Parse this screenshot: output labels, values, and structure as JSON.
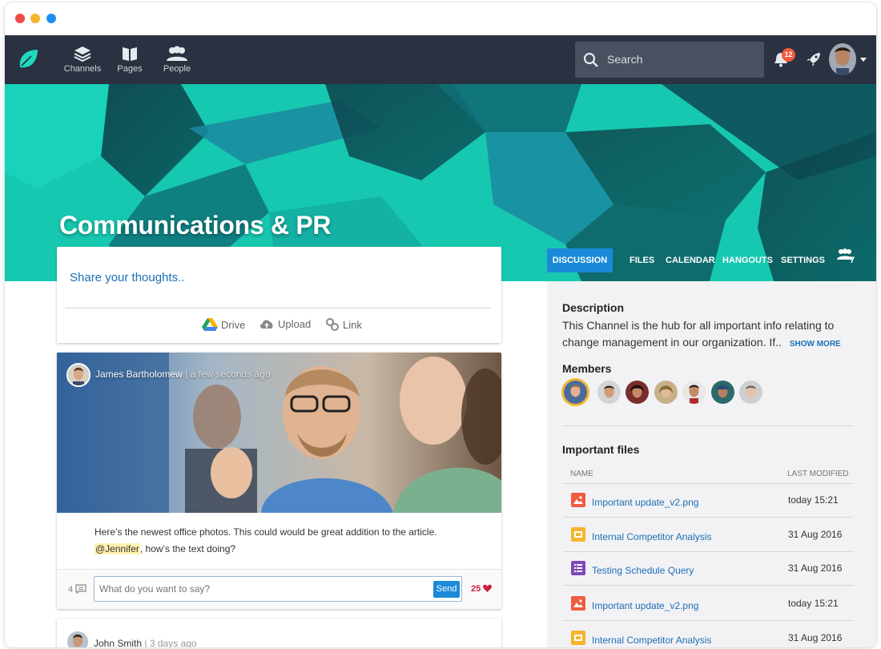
{
  "nav": {
    "items": [
      {
        "label": "Channels",
        "icon": "layers-icon"
      },
      {
        "label": "Pages",
        "icon": "book-icon"
      },
      {
        "label": "People",
        "icon": "people-icon"
      }
    ],
    "search_placeholder": "Search",
    "notification_count": "12"
  },
  "channel": {
    "title": "Communications & PR",
    "tabs": [
      "DISCUSSION",
      "FILES",
      "CALENDAR",
      "HANGOUTS",
      "SETTINGS"
    ],
    "member_count": "7",
    "active_tab": "DISCUSSION"
  },
  "composer": {
    "prompt": "Share your thoughts..",
    "attachments": [
      {
        "label": "Drive",
        "icon": "drive-icon"
      },
      {
        "label": "Upload",
        "icon": "cloud-upload-icon"
      },
      {
        "label": "Link",
        "icon": "link-icon"
      }
    ]
  },
  "post": {
    "author": "James Bartholomew",
    "time": "a few seconds ago",
    "text": "Here’s the newest office photos. This could would be great addition to the article.",
    "mention": "@Jennifer",
    "text_after_mention": ", how’s the text doing?",
    "comment_count": "4",
    "reply_placeholder": "What do you want to say?",
    "send_label": "Send",
    "likes": "25"
  },
  "post2": {
    "author": "John Smith",
    "time": "3 days ago"
  },
  "sidebar": {
    "description_heading": "Description",
    "description": "This Channel is the hub for all important info relating to change management in our organization. If..",
    "show_more": "SHOW MORE",
    "members_heading": "Members",
    "files_heading": "Important files",
    "col_name": "NAME",
    "col_modified": "LAST MODIFIED",
    "files": [
      {
        "name": "Important update_v2.png",
        "modified": "today 15:21",
        "type": "image",
        "color": "#f05b41"
      },
      {
        "name": "Internal Competitor Analysis",
        "modified": "31 Aug 2016",
        "type": "slides",
        "color": "#f5b52d"
      },
      {
        "name": "Testing Schedule Query",
        "modified": "31 Aug 2016",
        "type": "form",
        "color": "#7a4bb8"
      },
      {
        "name": "Important update_v2.png",
        "modified": "today 15:21",
        "type": "image",
        "color": "#f05b41"
      },
      {
        "name": "Internal Competitor Analysis",
        "modified": "31 Aug 2016",
        "type": "slides",
        "color": "#f5b52d"
      }
    ]
  },
  "colors": {
    "accent": "#1a8ad8",
    "navbar": "#2a3140",
    "hero": "#1fd6be",
    "link": "#1b6fb6"
  }
}
